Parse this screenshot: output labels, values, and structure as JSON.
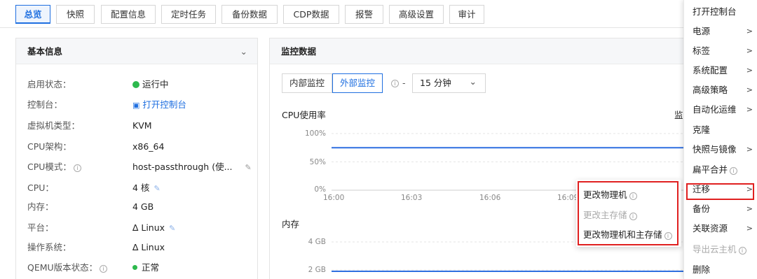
{
  "tabs": [
    {
      "label": "总览",
      "active": true
    },
    {
      "label": "快照"
    },
    {
      "label": "配置信息"
    },
    {
      "label": "定时任务"
    },
    {
      "label": "备份数据"
    },
    {
      "label": "CDP数据"
    },
    {
      "label": "报警"
    },
    {
      "label": "高级设置"
    },
    {
      "label": "审计"
    }
  ],
  "basic_info": {
    "title": "基本信息",
    "rows": [
      {
        "label": "启用状态：",
        "value": "运行中"
      },
      {
        "label": "控制台：",
        "value": "打开控制台"
      },
      {
        "label": "虚拟机类型：",
        "value": "KVM"
      },
      {
        "label": "CPU架构：",
        "value": "x86_64"
      },
      {
        "label": "CPU模式：",
        "value": "host-passthrough (使..."
      },
      {
        "label": "CPU：",
        "value": "4 核"
      },
      {
        "label": "内存：",
        "value": "4 GB"
      },
      {
        "label": "平台：",
        "value": "Linux"
      },
      {
        "label": "操作系统：",
        "value": "Linux"
      },
      {
        "label": "QEMU版本状态：",
        "value": "正常"
      }
    ]
  },
  "monitor": {
    "title": "监控数据",
    "internal_label": "内部监控",
    "external_label": "外部监控",
    "dash": "-",
    "range_value": "15 分钟",
    "cpu_title": "CPU使用率",
    "mem_title": "内存",
    "cpu_overflow_text": "监",
    "cpu_y_ticks": [
      "100%",
      "50%",
      "0%"
    ],
    "x_ticks": [
      "16:00",
      "16:03",
      "16:06",
      "16:09"
    ],
    "mem_y_ticks": [
      "4 GB",
      "2 GB"
    ],
    "line_color": "#2f6fe0"
  },
  "chart_data": [
    {
      "type": "line",
      "title": "CPU使用率",
      "x": [
        "16:00",
        "16:03",
        "16:06",
        "16:09"
      ],
      "series": [
        {
          "values": [
            75,
            75,
            75,
            75
          ]
        }
      ],
      "ylim": [
        0,
        100
      ],
      "yticks": [
        "0%",
        "50%",
        "100%"
      ]
    },
    {
      "type": "line",
      "title": "内存",
      "series": [
        {
          "values": [
            1.9,
            1.9,
            1.9,
            1.9
          ]
        }
      ],
      "yticks": [
        "2 GB",
        "4 GB"
      ]
    }
  ],
  "context_menu": {
    "items": [
      {
        "label": "打开控制台"
      },
      {
        "label": "电源",
        "arrow": true
      },
      {
        "label": "标签",
        "arrow": true
      },
      {
        "label": "系统配置",
        "arrow": true
      },
      {
        "label": "高级策略",
        "arrow": true
      },
      {
        "label": "自动化运维",
        "arrow": true
      },
      {
        "label": "克隆"
      },
      {
        "label": "快照与镜像",
        "arrow": true
      },
      {
        "label": "扁平合并",
        "info": true
      },
      {
        "label": "迁移",
        "arrow": true,
        "highlight": true
      },
      {
        "label": "备份",
        "arrow": true
      },
      {
        "label": "关联资源",
        "arrow": true
      },
      {
        "label": "导出云主机",
        "info": true,
        "disabled": true
      },
      {
        "label": "删除"
      }
    ]
  },
  "migrate_submenu": {
    "items": [
      {
        "label": "更改物理机",
        "info": true
      },
      {
        "label": "更改主存储",
        "info": true,
        "disabled": true
      },
      {
        "label": "更改物理机和主存储",
        "info": true
      }
    ]
  },
  "arrow_glyph": ">",
  "info_glyph": "i",
  "chevron_glyph": "⌄",
  "colors": {
    "accent": "#1f6fe0",
    "highlight": "#e02020",
    "status_green": "#2db94d"
  }
}
